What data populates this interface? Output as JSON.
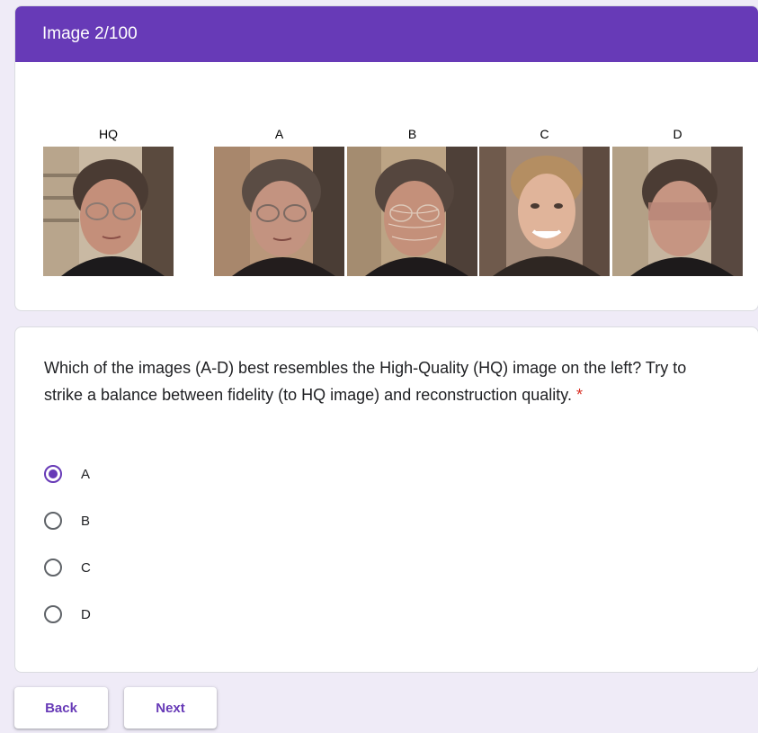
{
  "section": {
    "title": "Image 2/100"
  },
  "images": [
    {
      "label": "HQ"
    },
    {
      "label": "A"
    },
    {
      "label": "B"
    },
    {
      "label": "C"
    },
    {
      "label": "D"
    }
  ],
  "question": {
    "text": "Which of the images (A-D) best resembles the High-Quality (HQ) image on the left? Try to strike a balance between fidelity (to HQ image) and reconstruction quality.",
    "required_marker": "*",
    "selected": "A",
    "options": [
      {
        "label": "A",
        "checked": true
      },
      {
        "label": "B",
        "checked": false
      },
      {
        "label": "C",
        "checked": false
      },
      {
        "label": "D",
        "checked": false
      }
    ]
  },
  "buttons": {
    "back": "Back",
    "next": "Next"
  },
  "colors": {
    "accent": "#673ab7",
    "background": "#efebf7",
    "required": "#d93025"
  }
}
